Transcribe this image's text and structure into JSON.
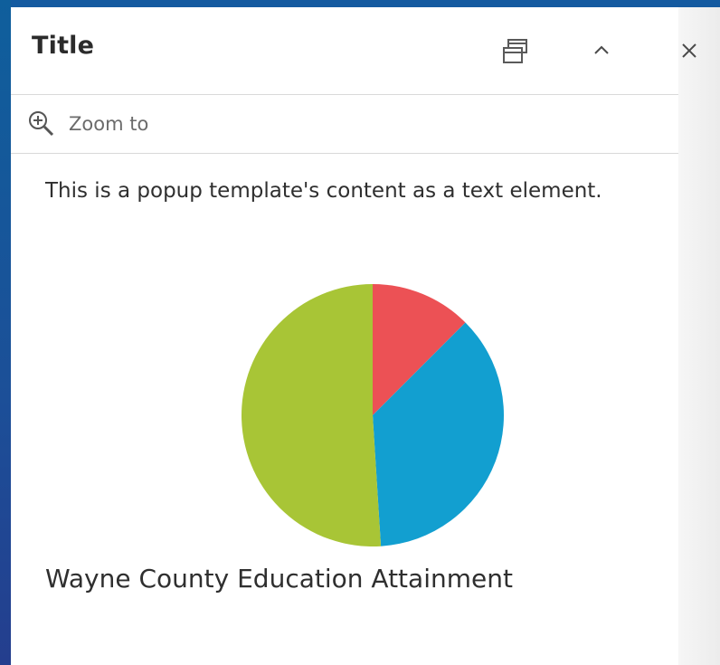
{
  "popup": {
    "title": "Title",
    "actions": {
      "dock_icon": "dock-icon",
      "collapse_icon": "chevron-up-icon",
      "close_icon": "close-icon"
    },
    "zoom": {
      "label": "Zoom to",
      "icon": "zoom-in-icon"
    },
    "text_content": "This is a popup template's content as a text element."
  },
  "colors": {
    "red": "#ec5155",
    "blue": "#129fd0",
    "green": "#a8c536"
  },
  "chart_data": {
    "type": "pie",
    "title": "Wayne County Education Attainment",
    "slices": [
      {
        "value": 12.5,
        "color": "#ec5155"
      },
      {
        "value": 36.5,
        "color": "#129fd0"
      },
      {
        "value": 51.0,
        "color": "#a8c536"
      }
    ]
  }
}
